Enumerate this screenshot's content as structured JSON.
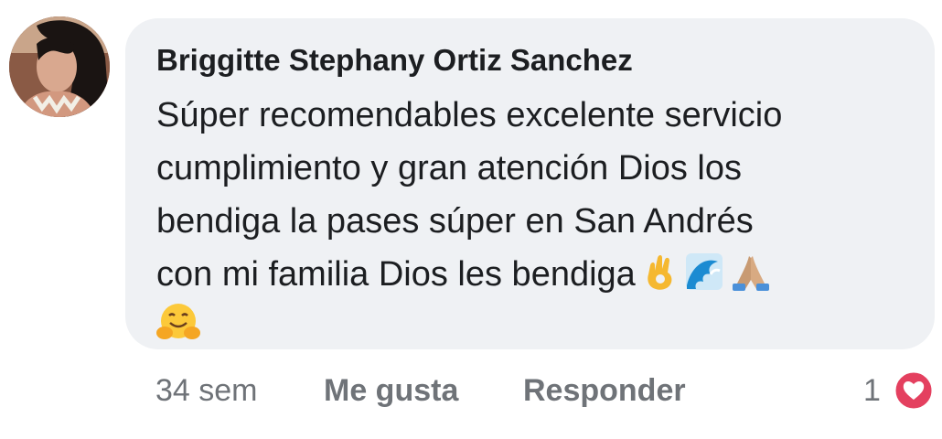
{
  "comment": {
    "author": "Briggitte Stephany Ortiz Sanchez",
    "lines": [
      "Súper recomendables excelente servicio",
      "cumplimiento y gran atención Dios los",
      "bendiga la pases súper en San Andrés",
      "con mi familia Dios les bendiga"
    ],
    "emojis": [
      "ok-hand-icon",
      "wave-icon",
      "praying-hands-icon",
      "hugging-face-icon"
    ]
  },
  "actions": {
    "time": "34 sem",
    "like_label": "Me gusta",
    "reply_label": "Responder",
    "reaction_count": "1",
    "reaction_icon": "heart-icon"
  },
  "colors": {
    "bubble_bg": "#eff1f4",
    "text": "#1c1e21",
    "muted": "#6f7378",
    "heart": "#e4405f"
  }
}
